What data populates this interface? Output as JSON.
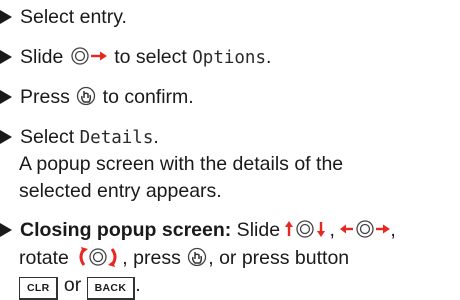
{
  "steps": [
    {
      "text": "Select entry."
    },
    {
      "pre": "Slide ",
      "post": " to select ",
      "code": "Options",
      "end": "."
    },
    {
      "pre": "Press ",
      "post": " to confirm."
    },
    {
      "pre": "Select ",
      "code": "Details",
      "end": ".",
      "line2": "A popup screen with the details of the",
      "line3": "selected entry appears."
    },
    {
      "bold": "Closing popup screen:",
      "pre": " Slide ",
      "sep1": ", ",
      "sep2": ",",
      "line2_pre": "rotate ",
      "line2_mid": ", press ",
      "line2_end": ", or press button",
      "key1": "CLR",
      "or": "or",
      "key2": "BACK",
      "end": "."
    }
  ],
  "colors": {
    "accent_red": "#e8281e",
    "text": "#1a1a1a"
  },
  "icons": [
    "bullet-arrow-icon",
    "controller-right-icon",
    "controller-press-icon",
    "controller-up-down-icon",
    "controller-left-right-icon",
    "controller-rotate-icon"
  ]
}
